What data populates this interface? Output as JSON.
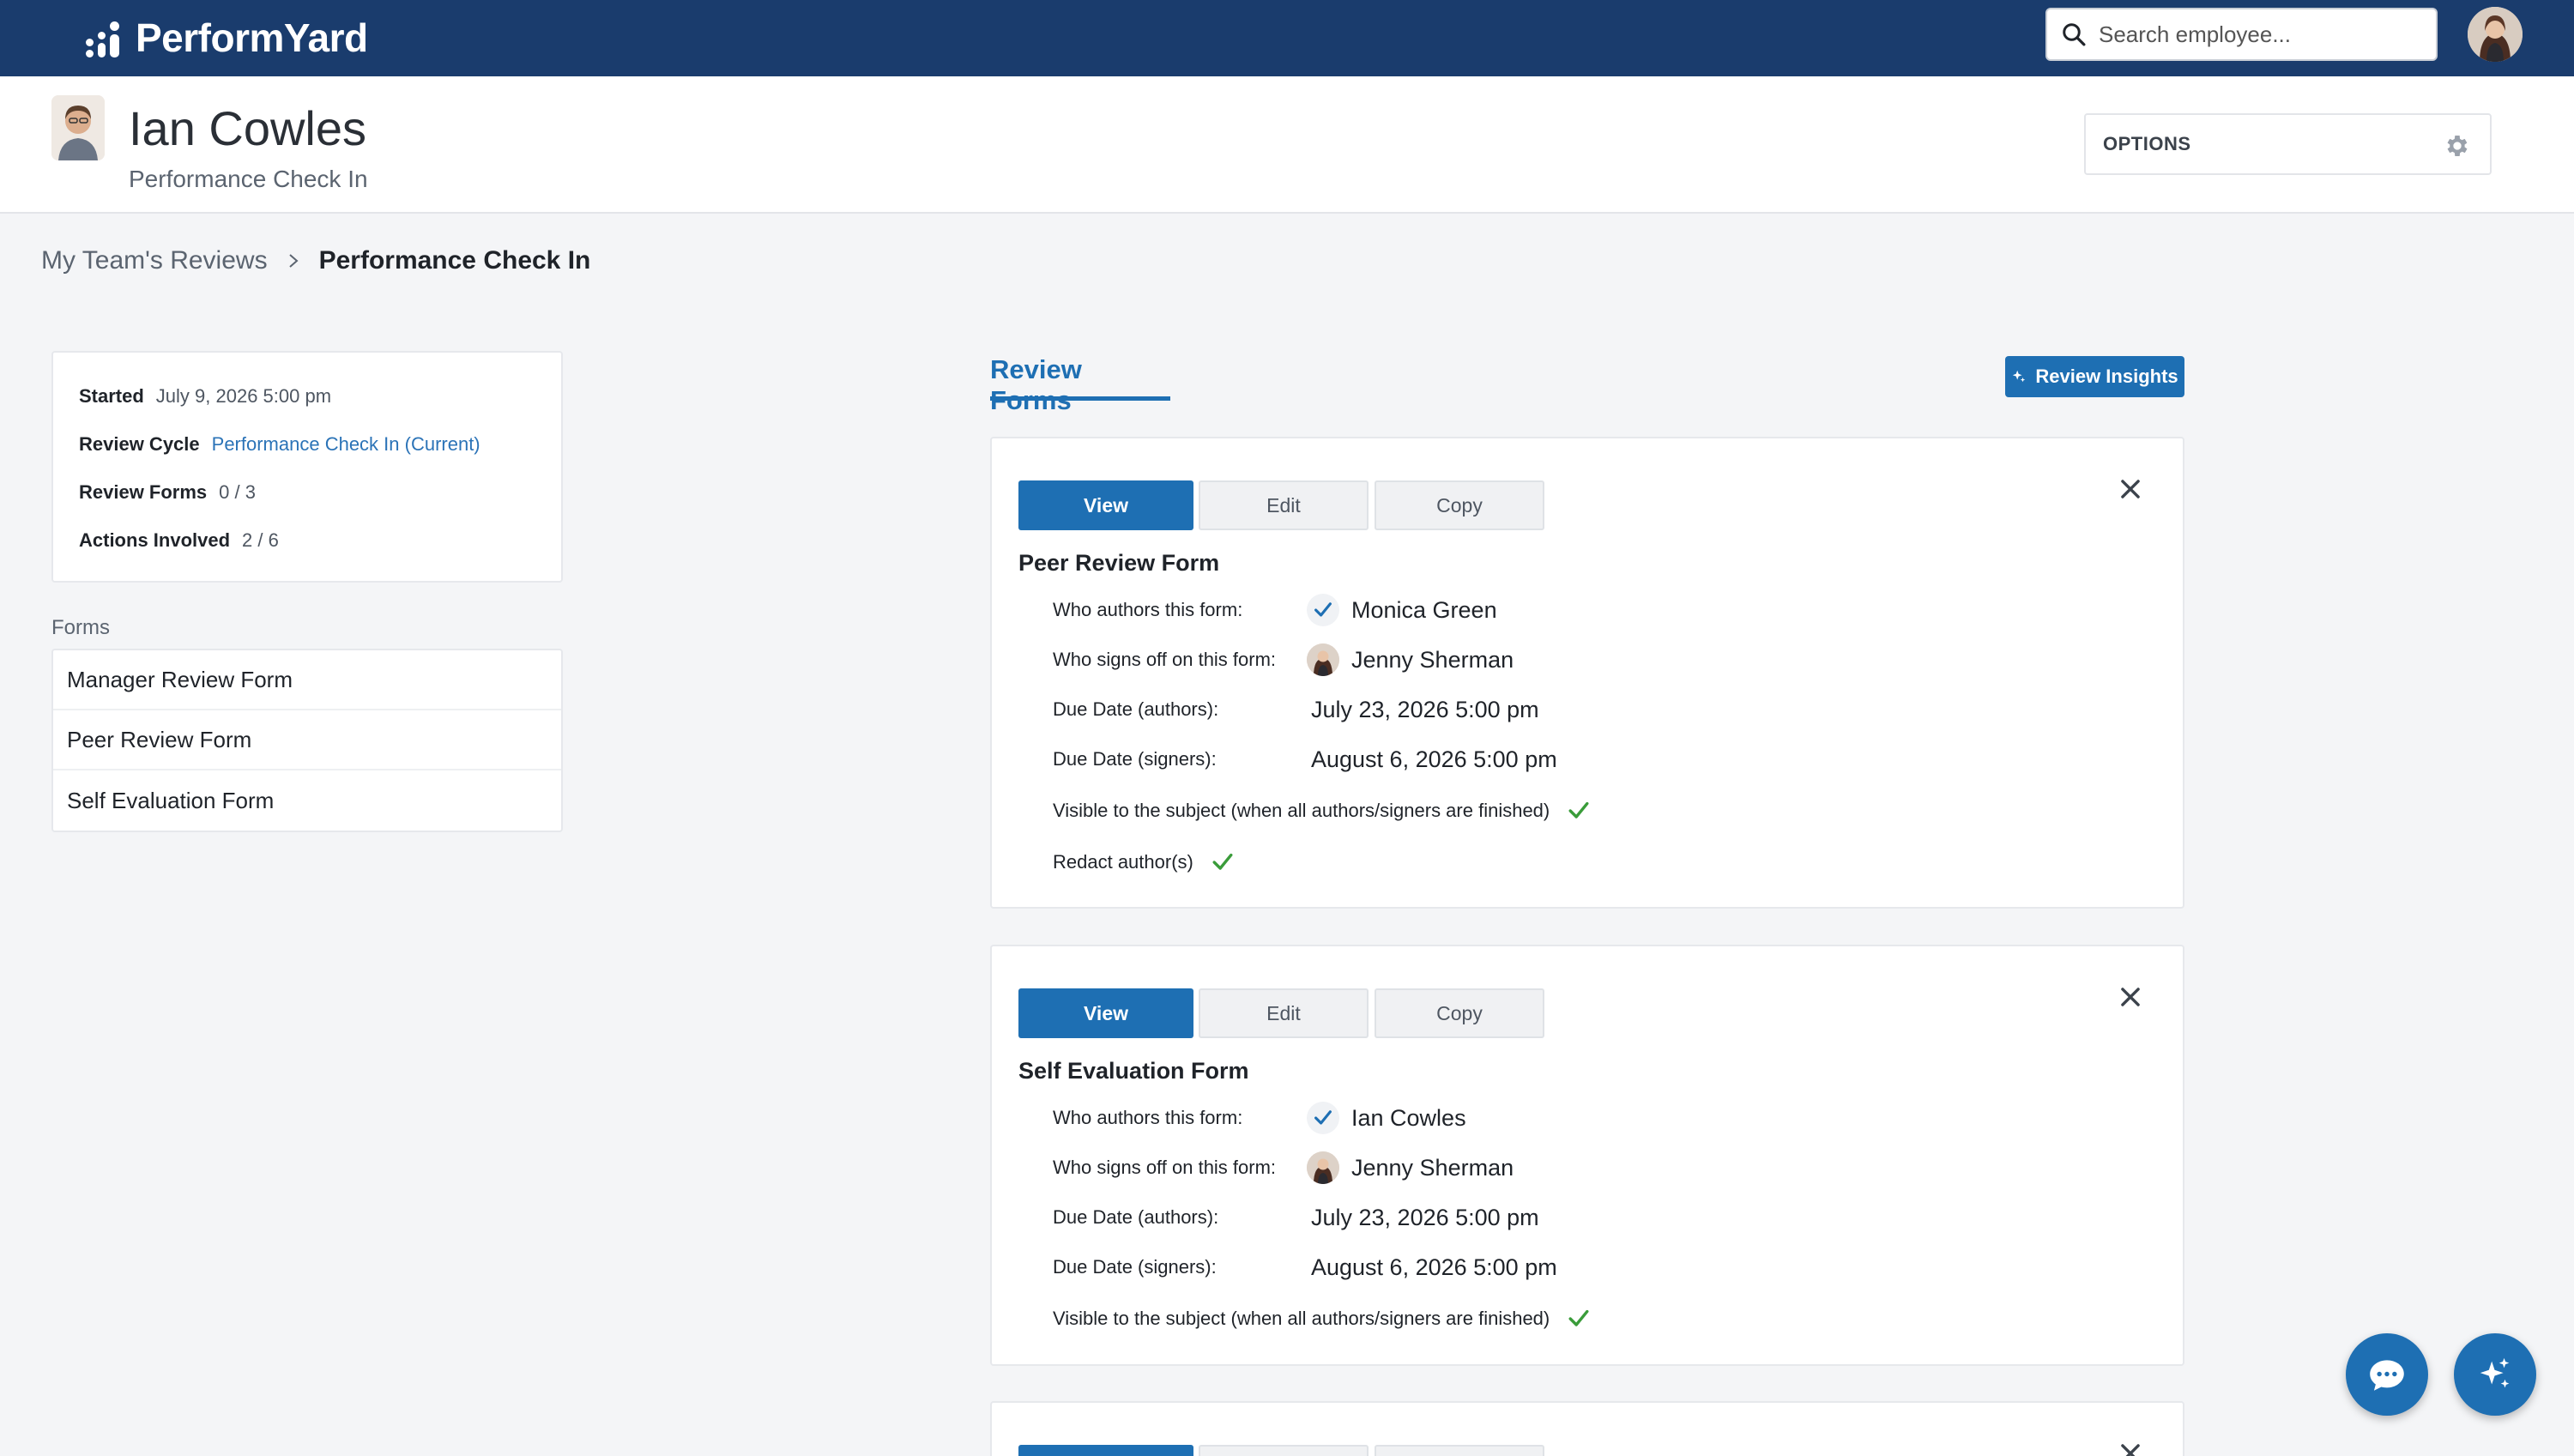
{
  "topbar": {
    "brand": "PerformYard",
    "search_placeholder": "Search employee..."
  },
  "subject": {
    "name": "Ian Cowles",
    "review_name": "Performance Check In",
    "options_label": "OPTIONS"
  },
  "breadcrumb": {
    "parent": "My Team's Reviews",
    "current": "Performance Check In"
  },
  "info": {
    "started_label": "Started",
    "started_value": "July 9, 2026 5:00 pm",
    "cycle_label": "Review Cycle",
    "cycle_value": "Performance Check In (Current)",
    "forms_label": "Review Forms",
    "forms_value": "0 / 3",
    "actions_label": "Actions Involved",
    "actions_value": "2 / 6"
  },
  "forms_sidebar": {
    "heading": "Forms",
    "items": [
      "Manager Review Form",
      "Peer Review Form",
      "Self Evaluation Form"
    ]
  },
  "tabs": {
    "review_forms": "Review Forms",
    "insights_button": "Review Insights"
  },
  "form_cards": [
    {
      "view": "View",
      "edit": "Edit",
      "copy": "Copy",
      "title": "Peer Review Form",
      "authors_label": "Who authors this form:",
      "author": "Monica Green",
      "signers_label": "Who signs off on this form:",
      "signer": "Jenny Sherman",
      "due_authors_label": "Due Date (authors):",
      "due_authors": "July 23, 2026 5:00 pm",
      "due_signers_label": "Due Date (signers):",
      "due_signers": "August 6, 2026 5:00 pm",
      "visible_label": "Visible to the subject (when all authors/signers are finished)",
      "redact_label": "Redact author(s)"
    },
    {
      "view": "View",
      "edit": "Edit",
      "copy": "Copy",
      "title": "Self Evaluation Form",
      "authors_label": "Who authors this form:",
      "author": "Ian Cowles",
      "signers_label": "Who signs off on this form:",
      "signer": "Jenny Sherman",
      "due_authors_label": "Due Date (authors):",
      "due_authors": "July 23, 2026 5:00 pm",
      "due_signers_label": "Due Date (signers):",
      "due_signers": "August 6, 2026 5:00 pm",
      "visible_label": "Visible to the subject (when all authors/signers are finished)"
    }
  ],
  "icons": {
    "search": "search-icon",
    "gear": "gear-icon",
    "chevron": "chevron-right-icon",
    "close": "close-icon",
    "check": "check-icon",
    "chat": "chat-icon",
    "sparkle": "sparkle-icon"
  },
  "colors": {
    "nav": "#1a3c6d",
    "primary": "#1e6fb3",
    "link": "#2b73b7",
    "success": "#3a9c3a"
  }
}
